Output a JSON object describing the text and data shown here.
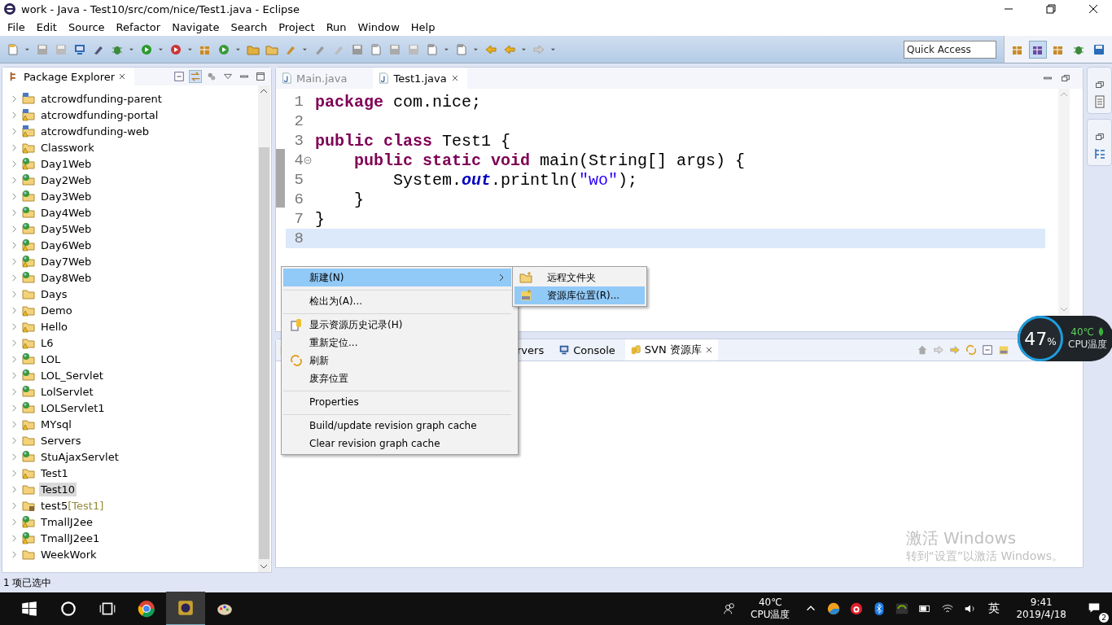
{
  "window": {
    "title": "work - Java - Test10/src/com/nice/Test1.java - Eclipse"
  },
  "menu_bar": [
    "File",
    "Edit",
    "Source",
    "Refactor",
    "Navigate",
    "Search",
    "Project",
    "Run",
    "Window",
    "Help"
  ],
  "quick_access": {
    "placeholder": "Quick Access"
  },
  "package_explorer": {
    "title": "Package Explorer",
    "items": [
      {
        "name": "atcrowdfunding-parent",
        "kind": "maven",
        "warning": false,
        "selected": false
      },
      {
        "name": "atcrowdfunding-portal",
        "kind": "maven",
        "warning": true,
        "selected": false
      },
      {
        "name": "atcrowdfunding-web",
        "kind": "maven",
        "warning": true,
        "selected": false
      },
      {
        "name": "Classwork",
        "kind": "java",
        "warning": true,
        "selected": false
      },
      {
        "name": "Day1Web",
        "kind": "web",
        "warning": true,
        "selected": false
      },
      {
        "name": "Day2Web",
        "kind": "web",
        "warning": false,
        "selected": false
      },
      {
        "name": "Day3Web",
        "kind": "web",
        "warning": false,
        "selected": false
      },
      {
        "name": "Day4Web",
        "kind": "web",
        "warning": false,
        "selected": false
      },
      {
        "name": "Day5Web",
        "kind": "web",
        "warning": false,
        "selected": false
      },
      {
        "name": "Day6Web",
        "kind": "web",
        "warning": true,
        "selected": false
      },
      {
        "name": "Day7Web",
        "kind": "web",
        "warning": true,
        "selected": false
      },
      {
        "name": "Day8Web",
        "kind": "web",
        "warning": false,
        "selected": false
      },
      {
        "name": "Days",
        "kind": "java",
        "warning": false,
        "selected": false
      },
      {
        "name": "Demo",
        "kind": "java",
        "warning": true,
        "selected": false
      },
      {
        "name": "Hello",
        "kind": "java",
        "warning": true,
        "selected": false
      },
      {
        "name": "L6",
        "kind": "java",
        "warning": true,
        "selected": false
      },
      {
        "name": "LOL",
        "kind": "web",
        "warning": false,
        "selected": false
      },
      {
        "name": "LOL_Servlet",
        "kind": "web",
        "warning": false,
        "selected": false
      },
      {
        "name": "LolServlet",
        "kind": "web",
        "warning": false,
        "selected": false
      },
      {
        "name": "LOLServlet1",
        "kind": "web",
        "warning": false,
        "selected": false
      },
      {
        "name": "MYsql",
        "kind": "java",
        "warning": true,
        "selected": false
      },
      {
        "name": "Servers",
        "kind": "java",
        "warning": false,
        "selected": false
      },
      {
        "name": "StuAjaxServlet",
        "kind": "web",
        "warning": false,
        "selected": false
      },
      {
        "name": "Test1",
        "kind": "java",
        "warning": true,
        "selected": false
      },
      {
        "name": "Test10",
        "kind": "java",
        "warning": false,
        "selected": true
      },
      {
        "name": "test5",
        "decoration": "[Test1]",
        "kind": "shared",
        "warning": false,
        "selected": false
      },
      {
        "name": "TmallJ2ee",
        "kind": "web",
        "warning": true,
        "selected": false
      },
      {
        "name": "TmallJ2ee1",
        "kind": "web",
        "warning": true,
        "selected": false
      },
      {
        "name": "WeekWork",
        "kind": "java",
        "warning": false,
        "selected": false
      }
    ]
  },
  "editor": {
    "tabs": [
      {
        "label": "Main.java",
        "selected": false
      },
      {
        "label": "Test1.java",
        "selected": true
      }
    ],
    "lines": [
      {
        "number": "1",
        "foldable": false,
        "current": false,
        "tokens": [
          {
            "kind": "keyword",
            "text": "package"
          },
          {
            "kind": "plain",
            "text": " com.nice;"
          }
        ]
      },
      {
        "number": "2",
        "foldable": false,
        "current": false
      },
      {
        "number": "3",
        "foldable": false,
        "current": false,
        "tokens": [
          {
            "kind": "keyword",
            "text": "public class"
          },
          {
            "kind": "plain",
            "text": " Test1 {"
          }
        ]
      },
      {
        "number": "4",
        "foldable": true,
        "current": false,
        "tokens": [
          {
            "kind": "keyword",
            "text": "    public static void"
          },
          {
            "kind": "plain",
            "text": " main(String[] args) {"
          }
        ]
      },
      {
        "number": "5",
        "foldable": false,
        "current": false,
        "tokens": [
          {
            "kind": "plain",
            "text": "        System."
          },
          {
            "kind": "field",
            "text": "out"
          },
          {
            "kind": "plain",
            "text": ".println("
          },
          {
            "kind": "string",
            "text": "\"wo\""
          },
          {
            "kind": "plain",
            "text": ");"
          }
        ]
      },
      {
        "number": "6",
        "foldable": false,
        "current": false,
        "tokens": [
          {
            "kind": "plain",
            "text": "    }"
          }
        ]
      },
      {
        "number": "7",
        "foldable": false,
        "current": false,
        "tokens": [
          {
            "kind": "plain",
            "text": "}"
          }
        ]
      },
      {
        "number": "8",
        "foldable": false,
        "current": true
      }
    ]
  },
  "bottom_panel": {
    "tabs": [
      {
        "label": "rvers",
        "selected": false
      },
      {
        "label": "Console",
        "selected": false
      },
      {
        "label": "SVN 资源库",
        "selected": true
      }
    ]
  },
  "context_menu": {
    "items": [
      {
        "label": "新建(N)",
        "submenu": true,
        "selected": true,
        "separator_before": false
      },
      {
        "label": "检出为(A)...",
        "submenu": false,
        "selected": false,
        "separator_before": true
      },
      {
        "label": "显示资源历史记录(H)",
        "submenu": false,
        "selected": false,
        "separator_before": true
      },
      {
        "label": "重新定位...",
        "submenu": false,
        "selected": false,
        "separator_before": false
      },
      {
        "label": "刷新",
        "submenu": false,
        "selected": false,
        "separator_before": false
      },
      {
        "label": "废弃位置",
        "submenu": false,
        "selected": false,
        "separator_before": false
      },
      {
        "label": "Properties",
        "submenu": false,
        "selected": false,
        "separator_before": true
      },
      {
        "label": "Build/update revision graph cache",
        "submenu": false,
        "selected": false,
        "separator_before": true
      },
      {
        "label": "Clear revision graph cache",
        "submenu": false,
        "selected": false,
        "separator_before": false
      }
    ]
  },
  "submenu": {
    "items": [
      {
        "label": "远程文件夹",
        "selected": false
      },
      {
        "label": "资源库位置(R)...",
        "selected": true
      }
    ]
  },
  "status_bar": {
    "text": "1 项已选中"
  },
  "cpu_widget": {
    "percent": "47",
    "unit": "%",
    "temperature": "40℃",
    "label": "CPU温度"
  },
  "activation_notice": {
    "title": "激活 Windows",
    "text": "转到“设置”以激活 Windows。"
  },
  "taskbar": {
    "temperature": "40℃",
    "temperature_label": "CPU温度",
    "language": "英",
    "time": "9:41",
    "date": "2019/4/18",
    "notifications": "2"
  }
}
